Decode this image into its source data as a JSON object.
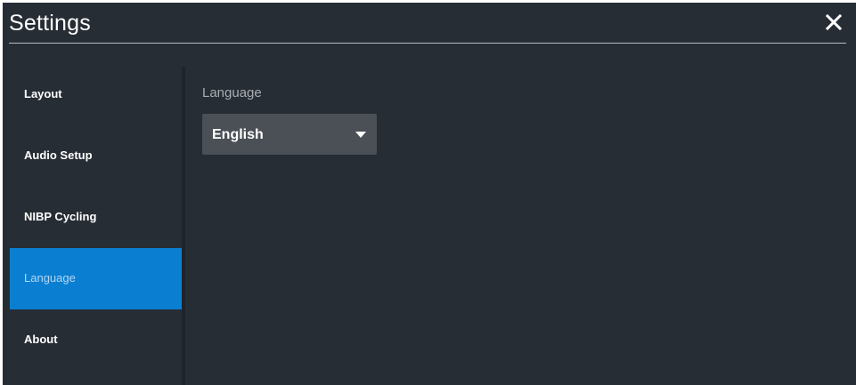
{
  "window": {
    "title": "Settings",
    "close_icon": "close-icon"
  },
  "sidebar": {
    "items": [
      {
        "label": "Layout",
        "active": false
      },
      {
        "label": "Audio Setup",
        "active": false
      },
      {
        "label": "NIBP Cycling",
        "active": false
      },
      {
        "label": "Language",
        "active": true
      },
      {
        "label": "About",
        "active": false
      }
    ]
  },
  "language": {
    "field_label": "Language",
    "selected": "English",
    "dropdown_icon": "caret-down-icon"
  },
  "colors": {
    "background": "#272d35",
    "accent": "#0a7fd2",
    "select_bg": "#4a5055"
  }
}
